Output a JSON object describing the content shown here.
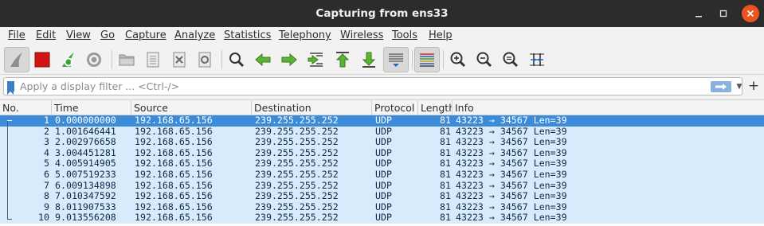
{
  "window": {
    "title": "Capturing from ens33"
  },
  "menu": [
    "File",
    "Edit",
    "View",
    "Go",
    "Capture",
    "Analyze",
    "Statistics",
    "Telephony",
    "Wireless",
    "Tools",
    "Help"
  ],
  "toolbar": {
    "icons": [
      "shark-fin-start-icon",
      "stop-capture-icon",
      "restart-capture-icon",
      "capture-options-icon",
      "open-file-icon",
      "save-file-icon",
      "close-file-icon",
      "reload-file-icon",
      "find-packet-icon",
      "go-back-icon",
      "go-forward-icon",
      "go-to-packet-icon",
      "go-first-packet-icon",
      "go-last-packet-icon",
      "auto-scroll-icon",
      "colorize-icon",
      "zoom-in-icon",
      "zoom-out-icon",
      "normal-size-icon",
      "resize-columns-icon"
    ]
  },
  "filter": {
    "placeholder": "Apply a display filter ... <Ctrl-/>",
    "plus": "+"
  },
  "packet_list": {
    "columns": [
      "No.",
      "Time",
      "Source",
      "Destination",
      "Protocol",
      "Length",
      "Info"
    ],
    "rows": [
      {
        "no": "1",
        "time": "0.000000000",
        "source": "192.168.65.156",
        "destination": "239.255.255.252",
        "protocol": "UDP",
        "length": "81",
        "info": "43223 → 34567 Len=39"
      },
      {
        "no": "2",
        "time": "1.001646441",
        "source": "192.168.65.156",
        "destination": "239.255.255.252",
        "protocol": "UDP",
        "length": "81",
        "info": "43223 → 34567 Len=39"
      },
      {
        "no": "3",
        "time": "2.002976658",
        "source": "192.168.65.156",
        "destination": "239.255.255.252",
        "protocol": "UDP",
        "length": "81",
        "info": "43223 → 34567 Len=39"
      },
      {
        "no": "4",
        "time": "3.004451281",
        "source": "192.168.65.156",
        "destination": "239.255.255.252",
        "protocol": "UDP",
        "length": "81",
        "info": "43223 → 34567 Len=39"
      },
      {
        "no": "5",
        "time": "4.005914905",
        "source": "192.168.65.156",
        "destination": "239.255.255.252",
        "protocol": "UDP",
        "length": "81",
        "info": "43223 → 34567 Len=39"
      },
      {
        "no": "6",
        "time": "5.007519233",
        "source": "192.168.65.156",
        "destination": "239.255.255.252",
        "protocol": "UDP",
        "length": "81",
        "info": "43223 → 34567 Len=39"
      },
      {
        "no": "7",
        "time": "6.009134898",
        "source": "192.168.65.156",
        "destination": "239.255.255.252",
        "protocol": "UDP",
        "length": "81",
        "info": "43223 → 34567 Len=39"
      },
      {
        "no": "8",
        "time": "7.010347592",
        "source": "192.168.65.156",
        "destination": "239.255.255.252",
        "protocol": "UDP",
        "length": "81",
        "info": "43223 → 34567 Len=39"
      },
      {
        "no": "9",
        "time": "8.011907533",
        "source": "192.168.65.156",
        "destination": "239.255.255.252",
        "protocol": "UDP",
        "length": "81",
        "info": "43223 → 34567 Len=39"
      },
      {
        "no": "10",
        "time": "9.013556208",
        "source": "192.168.65.156",
        "destination": "239.255.255.252",
        "protocol": "UDP",
        "length": "81",
        "info": "43223 → 34567 Len=39"
      }
    ],
    "selected_row": "1"
  },
  "colors": {
    "titlebar": "#2c2c2c",
    "close_button": "#e95420",
    "row_udp": "#d7ebfb",
    "row_selected": "#3b8bd9",
    "filter_bookmark": "#3b7fc4"
  }
}
